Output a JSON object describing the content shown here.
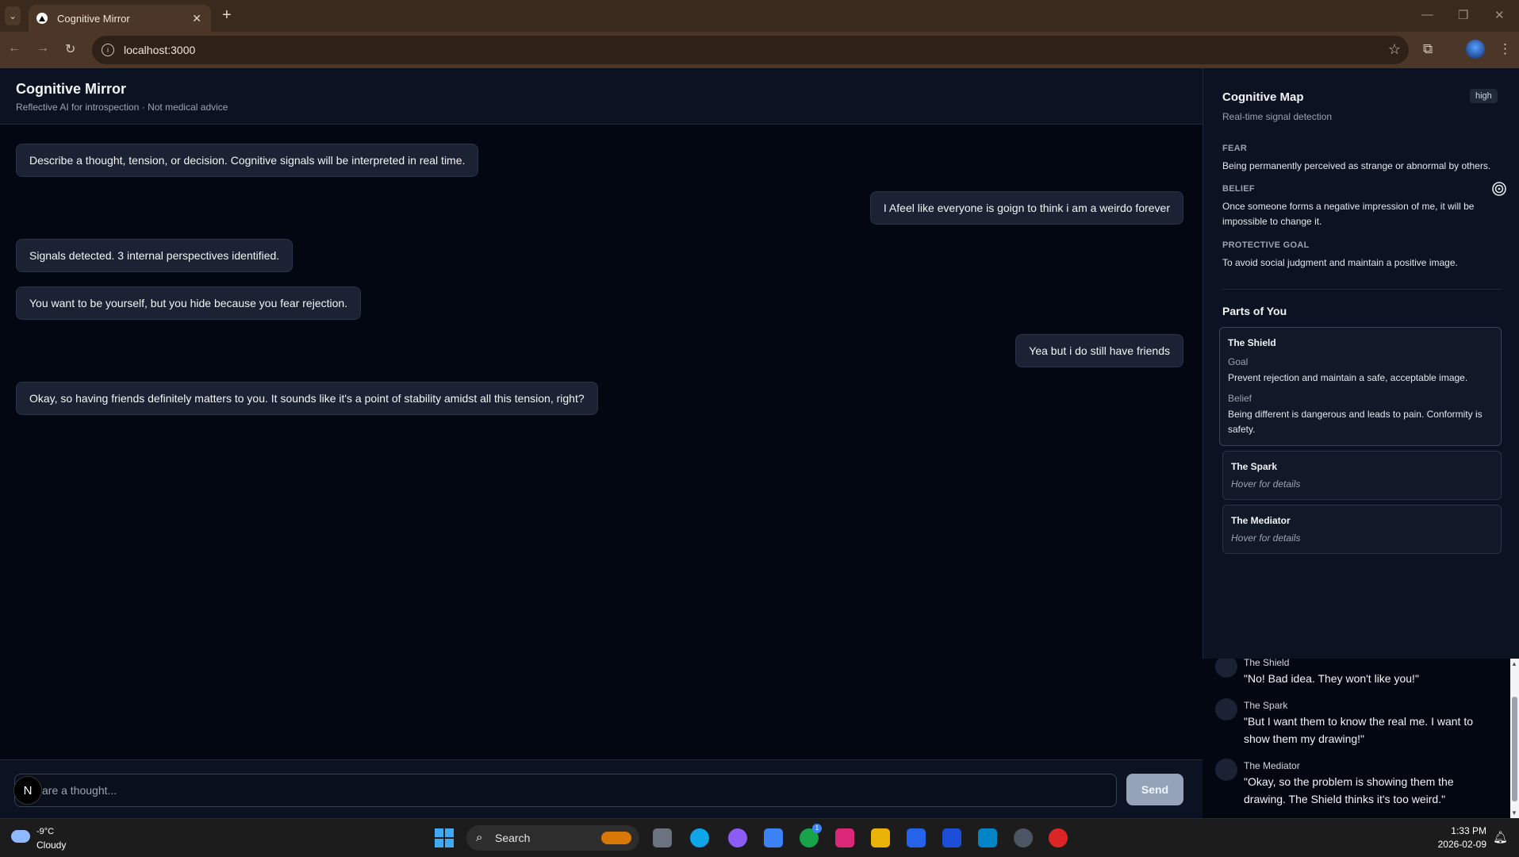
{
  "browser": {
    "tab_title": "Cognitive Mirror",
    "url": "localhost:3000",
    "new_tab": "+",
    "tab_close": "✕"
  },
  "app": {
    "title": "Cognitive Mirror",
    "subtitle": "Reflective AI for introspection · Not medical advice"
  },
  "chat": {
    "messages": [
      {
        "role": "assistant",
        "text": "Describe a thought, tension, or decision. Cognitive signals will be interpreted in real time."
      },
      {
        "role": "user",
        "text": "I Afeel like everyone is goign to think i am a weirdo forever"
      },
      {
        "role": "assistant",
        "text": "Signals detected. 3 internal perspectives identified."
      },
      {
        "role": "assistant",
        "text": "You want to be yourself, but you hide because you fear rejection."
      },
      {
        "role": "user",
        "text": "Yea but i do still have friends"
      },
      {
        "role": "assistant",
        "text": "Okay, so having friends definitely matters to you. It sounds like it's a point of stability amidst all this tension, right?"
      }
    ],
    "input_placeholder": "are a thought...",
    "send_label": "Send",
    "avatar_letter": "N"
  },
  "cognitive_map": {
    "title": "Cognitive Map",
    "subtitle": "Real-time signal detection",
    "level_badge": "high",
    "signals": [
      {
        "label": "FEAR",
        "text": "Being permanently perceived as strange or abnormal by others."
      },
      {
        "label": "BELIEF",
        "text": "Once someone forms a negative impression of me, it will be impossible to change it."
      },
      {
        "label": "PROTECTIVE GOAL",
        "text": "To avoid social judgment and maintain a positive image."
      }
    ]
  },
  "parts": {
    "title": "Parts of You",
    "items": [
      {
        "name": "The Shield",
        "goal_label": "Goal",
        "goal": "Prevent rejection and maintain a safe, acceptable image.",
        "belief_label": "Belief",
        "belief": "Being different is dangerous and leads to pain. Conformity is safety."
      },
      {
        "name": "The Spark",
        "hint": "Hover for details"
      },
      {
        "name": "The Mediator",
        "hint": "Hover for details"
      }
    ]
  },
  "dialogue": [
    {
      "speaker": "The Shield",
      "quote": "\"No! Bad idea. They won't like you!\""
    },
    {
      "speaker": "The Spark",
      "quote": "\"But I want them to know the real me. I want to show them my drawing!\""
    },
    {
      "speaker": "The Mediator",
      "quote": "\"Okay, so the problem is showing them the drawing. The Shield thinks it's too weird.\""
    }
  ],
  "taskbar": {
    "temperature": "-9°C",
    "condition": "Cloudy",
    "search_label": "Search",
    "time": "1:33 PM",
    "date": "2026-02-09",
    "xbox_badge": "1"
  },
  "colors": {
    "background": "#030712",
    "panel": "#0b1222",
    "bubble": "#1a2233",
    "accent_browser": "#4b3627"
  }
}
